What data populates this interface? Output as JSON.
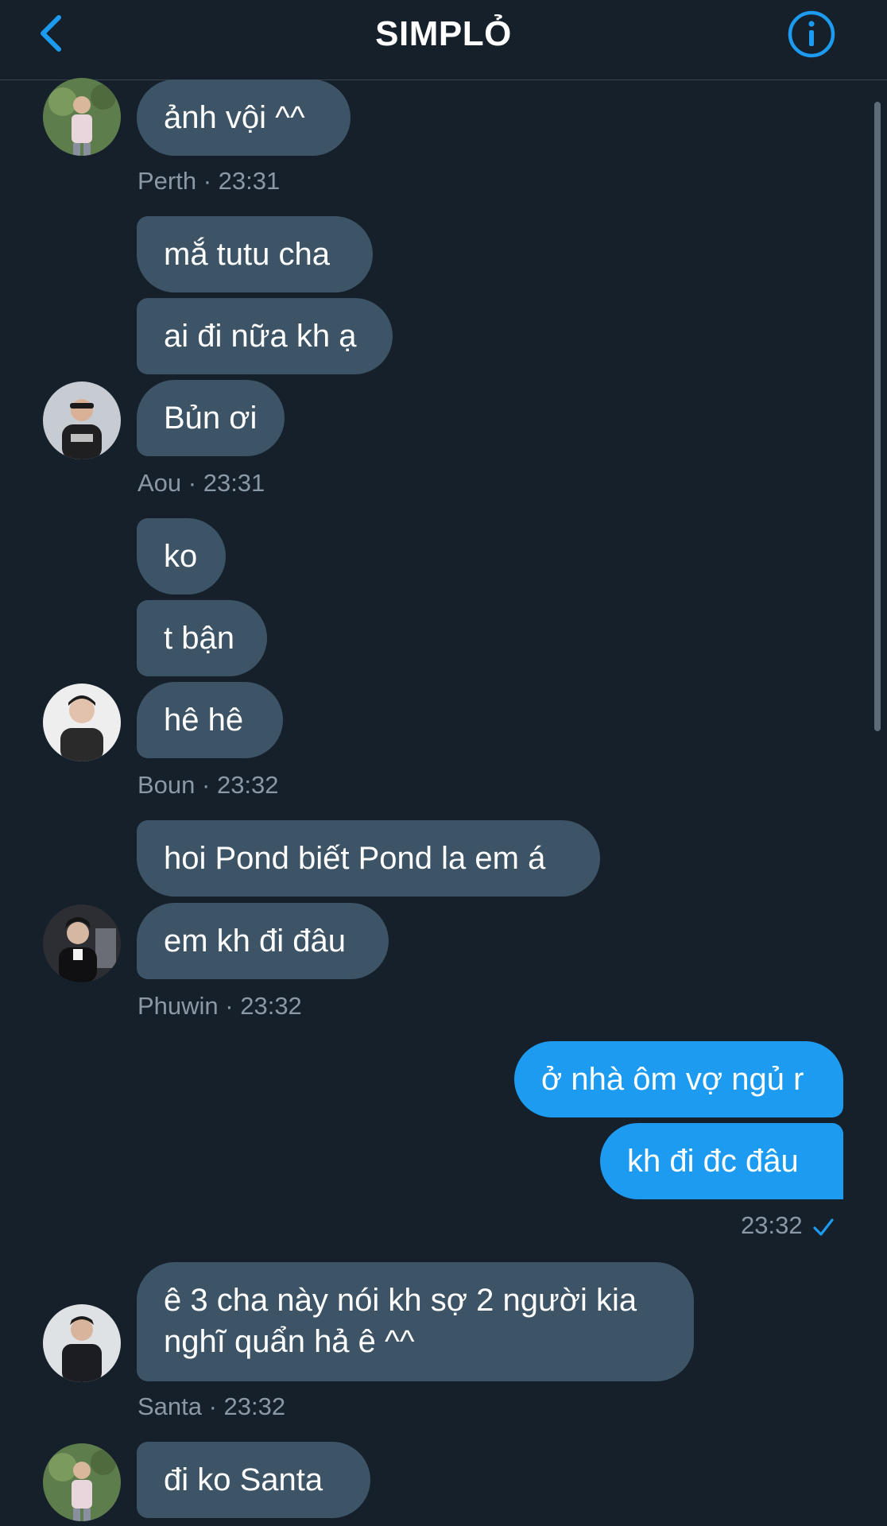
{
  "header": {
    "title": "SIMPLỎ",
    "back_icon": "chevron-left-icon",
    "info_icon": "info-icon",
    "accent": "#1d9bf0"
  },
  "messages": [
    {
      "sender": "Perth",
      "time": "23:31",
      "bubbles": [
        "ảnh vội ^^"
      ]
    },
    {
      "sender": "Aou",
      "time": "23:31",
      "bubbles": [
        "mắ tutu cha",
        "ai đi nữa kh ạ",
        "Bủn ơi"
      ]
    },
    {
      "sender": "Boun",
      "time": "23:32",
      "bubbles": [
        "ko",
        "t bận",
        "hê hê"
      ]
    },
    {
      "sender": "Phuwin",
      "time": "23:32",
      "bubbles": [
        "hoi Pond biết Pond la em á",
        "em kh đi đâu"
      ]
    },
    {
      "sender": "me",
      "time": "23:32",
      "bubbles": [
        "ở nhà ôm vợ ngủ r",
        "kh đi đc đâu"
      ],
      "status_icon": "check-icon"
    },
    {
      "sender": "Santa",
      "time": "23:32",
      "bubbles": [
        "ê 3 cha này nói kh sợ 2 người kia nghĩ quẩn hả ê ^^"
      ]
    },
    {
      "sender": "Perth",
      "time": "",
      "bubbles": [
        "đi ko Santa"
      ]
    }
  ],
  "meta_labels": {
    "perth": "Perth · 23:31",
    "aou": "Aou · 23:31",
    "boun": "Boun · 23:32",
    "phuwin": "Phuwin · 23:32",
    "me": "23:32",
    "santa": "Santa · 23:32"
  },
  "colors": {
    "background": "#15202b",
    "incoming_bubble": "#3d5466",
    "outgoing_bubble": "#1d9bf0",
    "meta_text": "#8b98a5"
  }
}
